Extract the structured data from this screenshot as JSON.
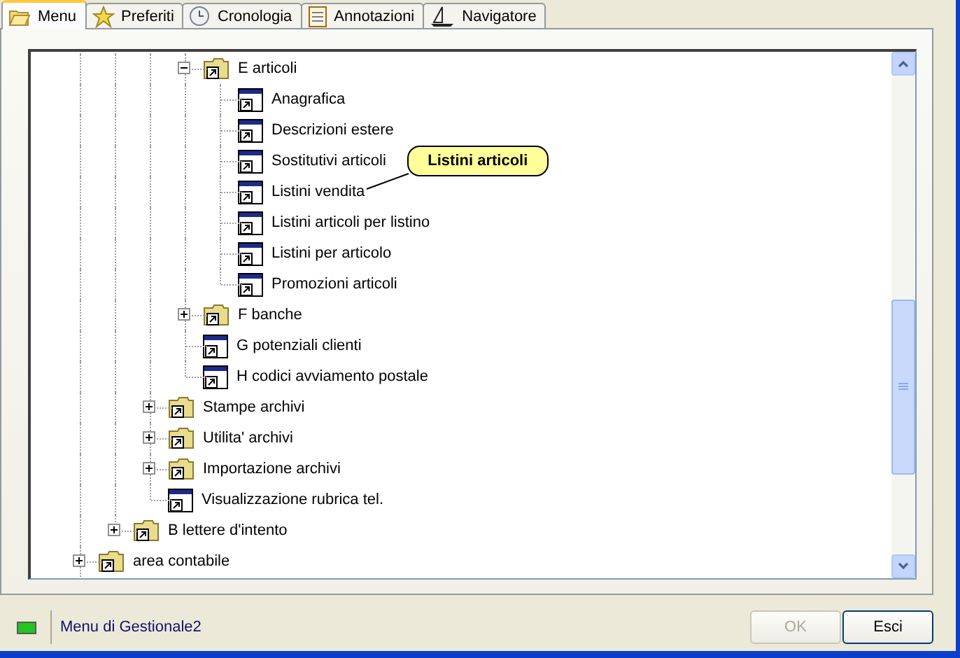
{
  "tabs": [
    {
      "label": "Menu",
      "kind": "folder",
      "selected": true
    },
    {
      "label": "Preferiti",
      "kind": "star",
      "selected": false
    },
    {
      "label": "Cronologia",
      "kind": "clock",
      "selected": false
    },
    {
      "label": "Annotazioni",
      "kind": "clipboard",
      "selected": false
    },
    {
      "label": "Navigatore",
      "kind": "sailboat",
      "selected": false
    }
  ],
  "tree": {
    "items": [
      {
        "children": [
          {
            "children": [
              {
                "children": [
                  {
                    "label": "E articoli",
                    "kind": "folder",
                    "expanded": true,
                    "children": [
                      {
                        "label": "Anagrafica",
                        "kind": "program"
                      },
                      {
                        "label": "Descrizioni estere",
                        "kind": "program"
                      },
                      {
                        "label": "Sostitutivi articoli",
                        "kind": "program"
                      },
                      {
                        "label": "Listini vendita",
                        "kind": "program",
                        "callout": "Listini articoli"
                      },
                      {
                        "label": "Listini articoli per listino",
                        "kind": "program"
                      },
                      {
                        "label": "Listini per articolo",
                        "kind": "program"
                      },
                      {
                        "label": "Promozioni articoli",
                        "kind": "program"
                      }
                    ]
                  },
                  {
                    "label": "F banche",
                    "kind": "folder",
                    "expanded": false
                  },
                  {
                    "label": "G potenziali clienti",
                    "kind": "program"
                  },
                  {
                    "label": "H codici avviamento postale",
                    "kind": "program"
                  }
                ]
              },
              {
                "label": "Stampe archivi",
                "kind": "folder",
                "expanded": false
              },
              {
                "label": "Utilita' archivi",
                "kind": "folder",
                "expanded": false
              },
              {
                "label": "Importazione archivi",
                "kind": "folder",
                "expanded": false
              },
              {
                "label": "Visualizzazione rubrica tel.",
                "kind": "program"
              }
            ]
          },
          {
            "label": "B lettere d'intento",
            "kind": "folder",
            "expanded": false
          }
        ]
      },
      {
        "label": "area contabile",
        "kind": "folder",
        "expanded": false
      }
    ]
  },
  "status_bar": {
    "text": "Menu di Gestionale2"
  },
  "buttons": [
    {
      "label": "OK",
      "disabled": true
    },
    {
      "label": "Esci",
      "disabled": false
    }
  ]
}
